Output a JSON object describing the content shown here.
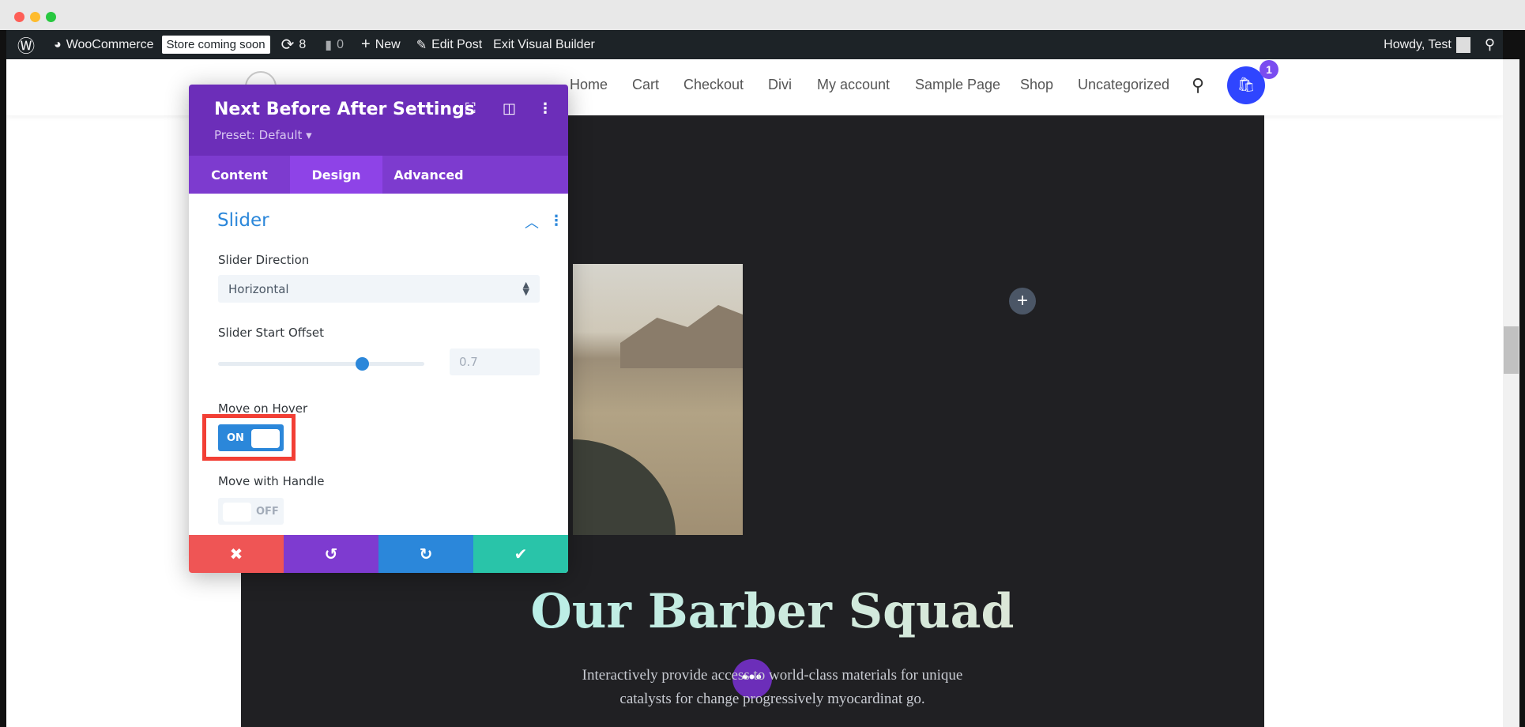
{
  "admin_bar": {
    "site": "WooCommerce",
    "store_badge": "Store coming soon",
    "updates": "8",
    "comments": "0",
    "new": "New",
    "edit_post": "Edit Post",
    "exit_builder": "Exit Visual Builder",
    "howdy": "Howdy, Test"
  },
  "nav": {
    "items": [
      "Home",
      "Cart",
      "Checkout",
      "Divi",
      "My account",
      "Sample Page",
      "Shop",
      "Uncategorized"
    ],
    "cart_count": "1",
    "logo_partial": "divi"
  },
  "page": {
    "heading": "Our Barber Squad",
    "para_line1": "Interactively provide access to world-class materials for unique",
    "para_line2": "catalysts for change progressively myocardinat go.",
    "more_dots": "•••"
  },
  "panel": {
    "title": "Next Before After Settings",
    "preset": "Preset: Default ▾",
    "tabs": [
      "Content",
      "Design",
      "Advanced"
    ],
    "active_tab": "Design",
    "section": "Slider",
    "slider_direction": {
      "label": "Slider Direction",
      "value": "Horizontal"
    },
    "slider_start_offset": {
      "label": "Slider Start Offset",
      "value": "0.7",
      "fraction": 0.7
    },
    "move_on_hover": {
      "label": "Move on Hover",
      "state": "ON"
    },
    "move_with_handle": {
      "label": "Move with Handle",
      "state": "OFF"
    }
  },
  "colors": {
    "purple": "#6c2eb9",
    "blue": "#2b87da",
    "cancel": "#ef5555",
    "undo": "#7e3bd0",
    "redo": "#2b87da",
    "save": "#29c4a9",
    "highlight": "#f23f35"
  }
}
